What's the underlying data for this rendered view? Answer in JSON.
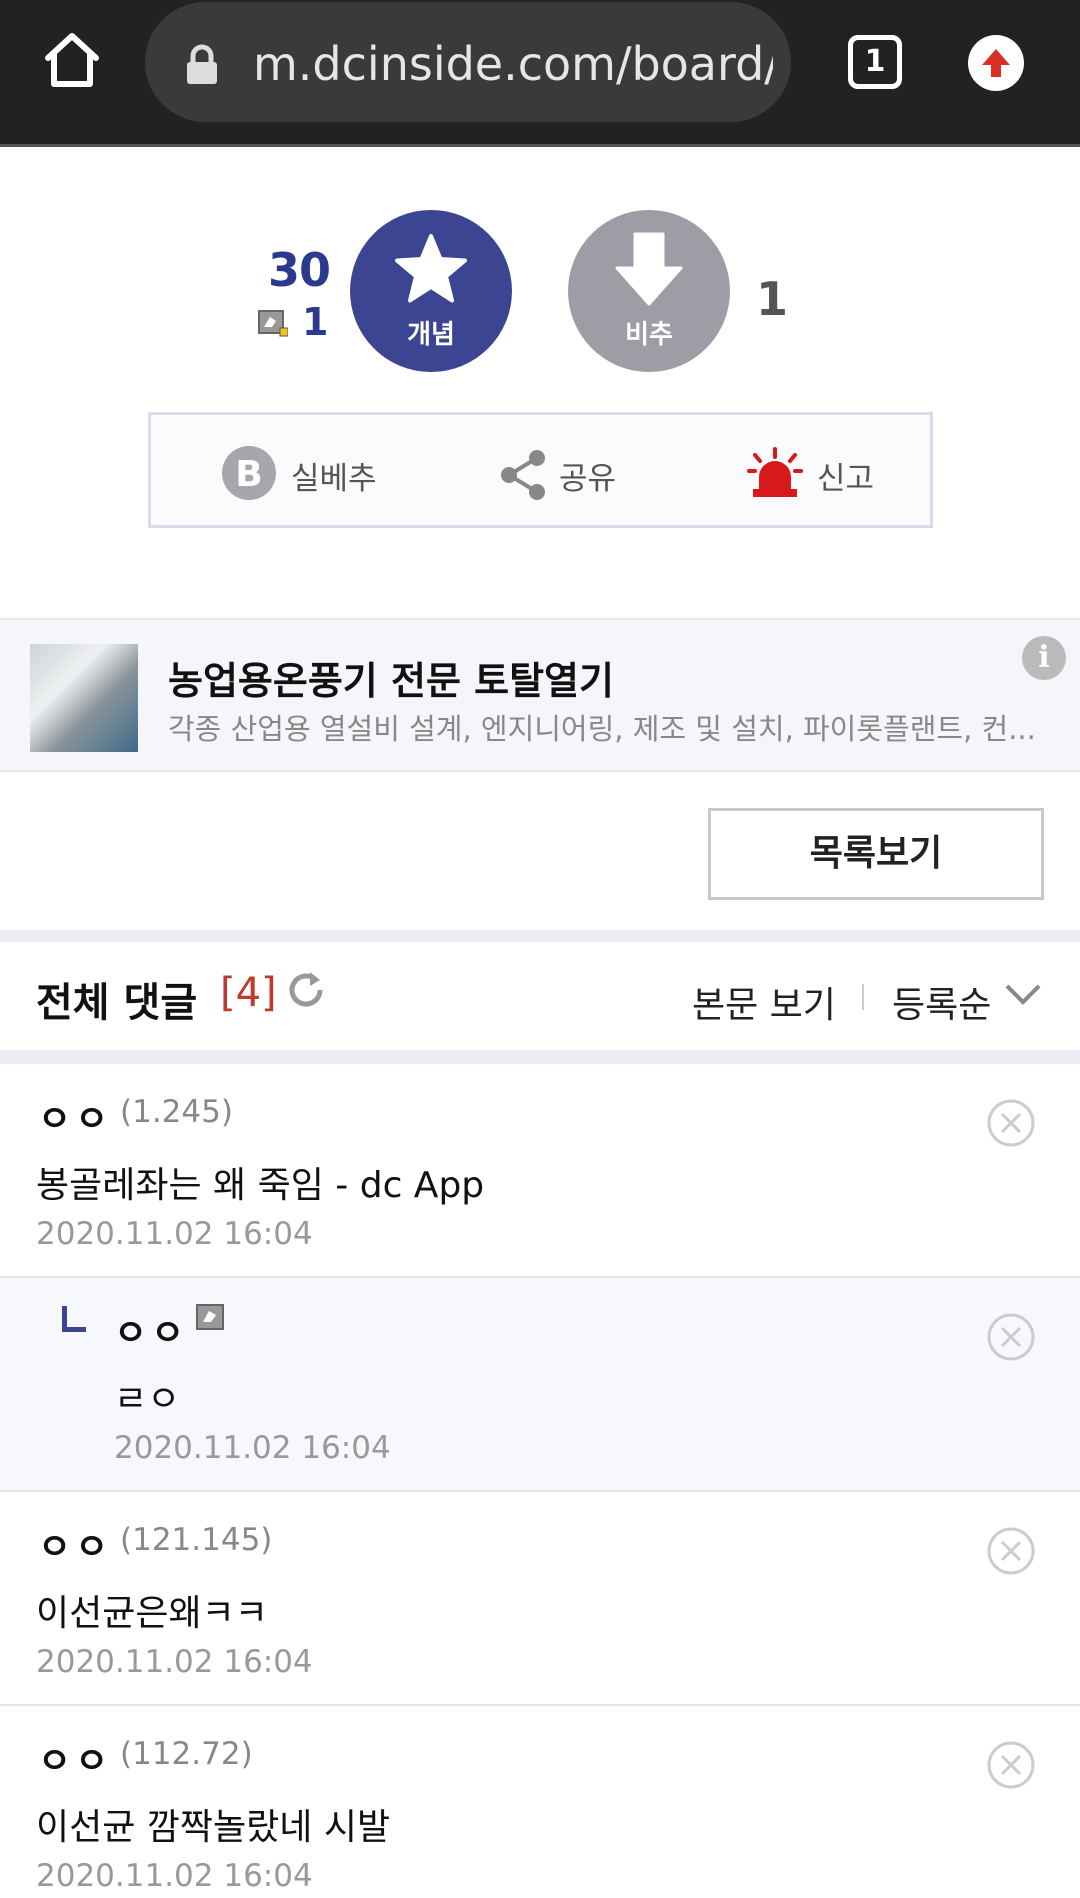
{
  "browser": {
    "url": "m.dcinside.com/board/l",
    "tab_count": "1",
    "colors": {
      "bar": "#222222",
      "upload": "#d93025"
    }
  },
  "vote": {
    "recommend_count": "30",
    "fixed_recommend_count": "1",
    "recommend_label": "개념",
    "nonrecommend_label": "비추",
    "nonrecommend_count": "1",
    "colors": {
      "recommend": "#3b4592",
      "nonrecommend": "#9d9da5"
    }
  },
  "actions": {
    "best_label": "실베추",
    "share_label": "공유",
    "report_label": "신고"
  },
  "ad": {
    "title": "농업용온풍기 전문 토탈열기",
    "description": "각종 산업용 열설비 설계, 엔지니어링, 제조 및 설치, 파이롯플랜트, 컨..."
  },
  "list_button_label": "목록보기",
  "comments_header": {
    "title": "전체 댓글",
    "count": "[4]",
    "view_body": "본문 보기",
    "sort": "등록순"
  },
  "comments": [
    {
      "nick": "ㅇㅇ",
      "ip": "(1.245)",
      "text": "봉골레좌는 왜 죽임 - dc App",
      "date": "2020.11.02 16:04"
    },
    {
      "nick": "ㅇㅇ",
      "text": "ㄹㅇ",
      "date": "2020.11.02 16:04"
    },
    {
      "nick": "ㅇㅇ",
      "ip": "(121.145)",
      "text": "이선균은왜ㅋㅋ",
      "date": "2020.11.02 16:04"
    },
    {
      "nick": "ㅇㅇ",
      "ip": "(112.72)",
      "text": "이선균 깜짝놀랐네 시발",
      "date": "2020.11.02 16:04"
    }
  ]
}
